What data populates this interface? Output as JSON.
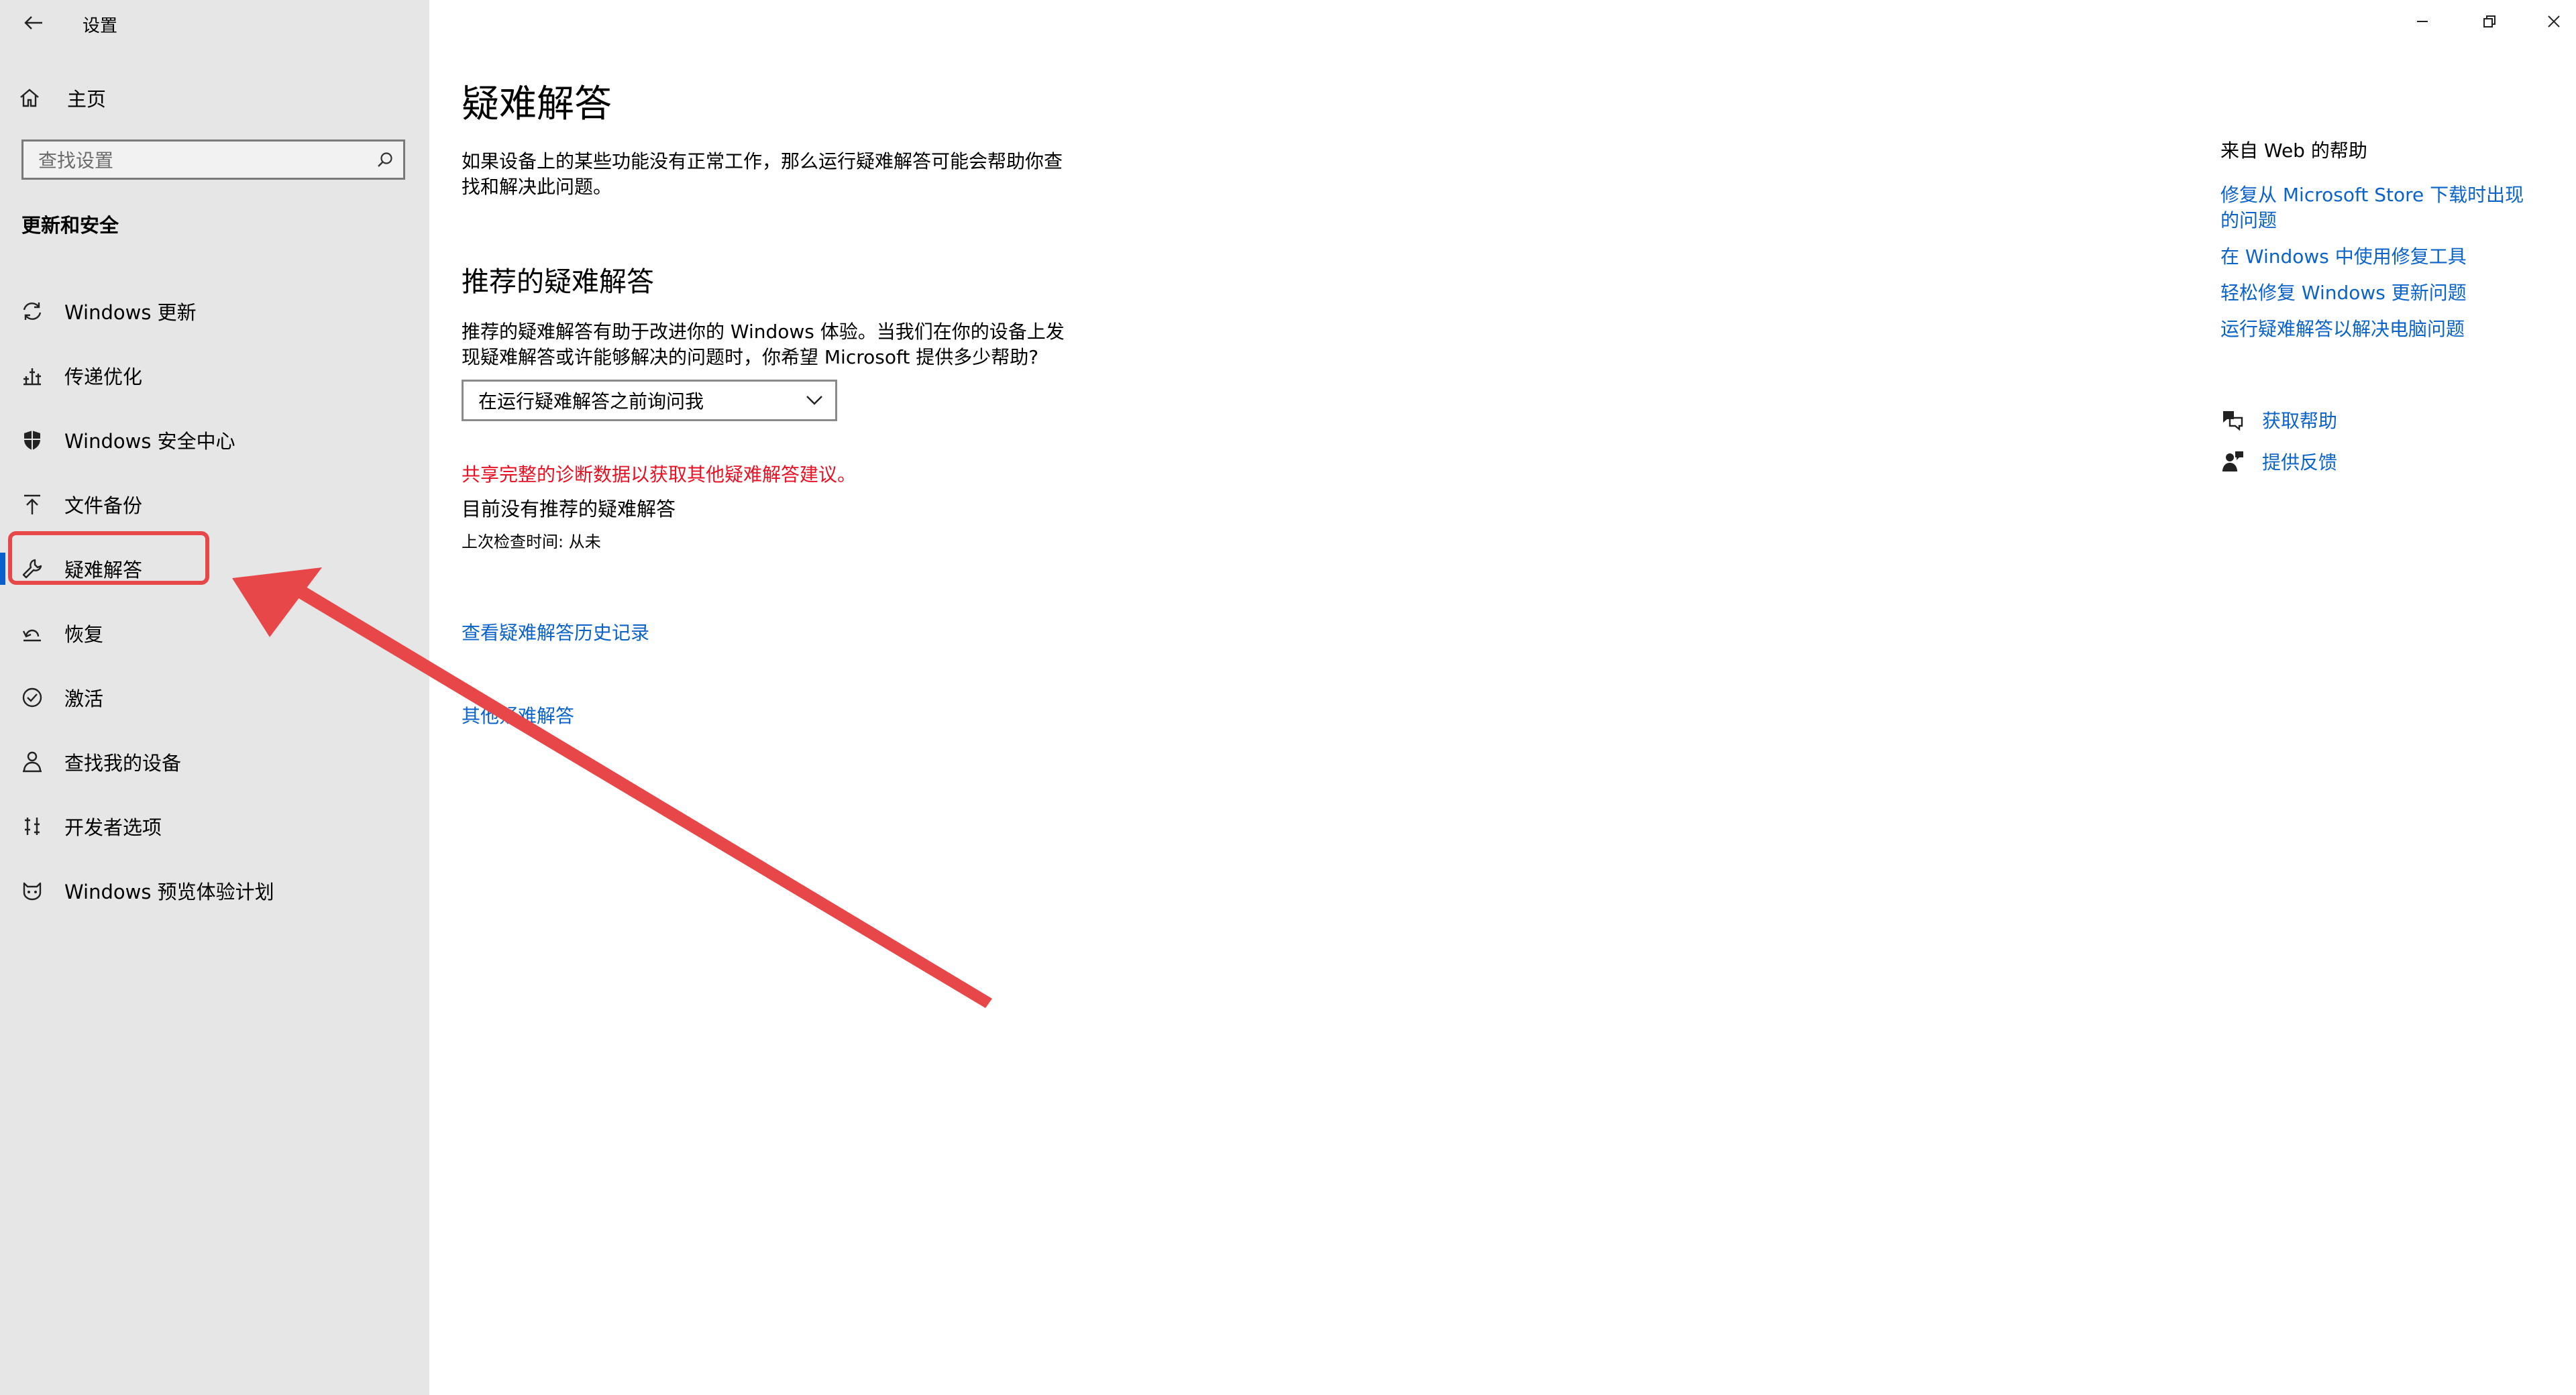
{
  "app": {
    "title": "设置"
  },
  "sidebar": {
    "home_label": "主页",
    "search_placeholder": "查找设置",
    "section_title": "更新和安全",
    "items": [
      {
        "label": "Windows 更新",
        "icon": "refresh-icon"
      },
      {
        "label": "传递优化",
        "icon": "delivery-optimization-icon"
      },
      {
        "label": "Windows 安全中心",
        "icon": "shield-icon"
      },
      {
        "label": "文件备份",
        "icon": "upload-arrow-icon"
      },
      {
        "label": "疑难解答",
        "icon": "wrench-icon",
        "selected": true
      },
      {
        "label": "恢复",
        "icon": "recovery-icon"
      },
      {
        "label": "激活",
        "icon": "check-circle-icon"
      },
      {
        "label": "查找我的设备",
        "icon": "person-locate-icon"
      },
      {
        "label": "开发者选项",
        "icon": "developer-icon"
      },
      {
        "label": "Windows 预览体验计划",
        "icon": "insider-cat-icon"
      }
    ]
  },
  "main": {
    "title": "疑难解答",
    "intro": "如果设备上的某些功能没有正常工作，那么运行疑难解答可能会帮助你查找和解决此问题。",
    "recommended": {
      "heading": "推荐的疑难解答",
      "description": "推荐的疑难解答有助于改进你的 Windows 体验。当我们在你的设备上发现疑难解答或许能够解决的问题时，你希望 Microsoft 提供多少帮助?",
      "dropdown_value": "在运行疑难解答之前询问我",
      "warning": "共享完整的诊断数据以获取其他疑难解答建议。",
      "no_recommendations": "目前没有推荐的疑难解答",
      "last_check": "上次检查时间: 从未"
    },
    "history_link": "查看疑难解答历史记录",
    "other_link": "其他疑难解答"
  },
  "right_pane": {
    "title": "来自 Web 的帮助",
    "links": [
      "修复从 Microsoft Store 下载时出现的问题",
      "在 Windows 中使用修复工具",
      "轻松修复 Windows 更新问题",
      "运行疑难解答以解决电脑问题"
    ],
    "get_help": "获取帮助",
    "feedback": "提供反馈"
  },
  "colors": {
    "accent": "#0a63c9",
    "warning": "#e81123",
    "annotation": "#e8474a",
    "sidebar_bg": "#e6e6e6"
  }
}
